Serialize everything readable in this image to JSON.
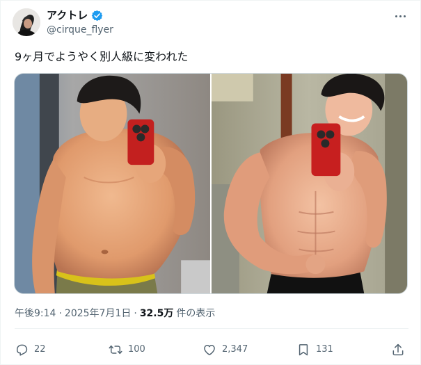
{
  "user": {
    "display_name": "アクトレ",
    "handle": "@cirque_flyer",
    "verified": true,
    "avatar_icon": "avatar-photo"
  },
  "tweet": {
    "text": "9ヶ月でようやく別人級に変われた",
    "images": [
      {
        "description": "before-mirror-selfie"
      },
      {
        "description": "after-mirror-selfie"
      }
    ],
    "time": "午後9:14",
    "separator": "·",
    "date": "2025年7月1日",
    "views_count": "32.5万",
    "views_label": "件の表示"
  },
  "actions": {
    "reply": {
      "icon": "reply-icon",
      "count": "22"
    },
    "retweet": {
      "icon": "retweet-icon",
      "count": "100"
    },
    "like": {
      "icon": "heart-icon",
      "count": "2,347"
    },
    "bookmark": {
      "icon": "bookmark-icon",
      "count": "131"
    },
    "share": {
      "icon": "share-icon"
    }
  },
  "colors": {
    "verified_badge": "#1d9bf0",
    "secondary_text": "#536471",
    "primary_text": "#0f1419"
  }
}
